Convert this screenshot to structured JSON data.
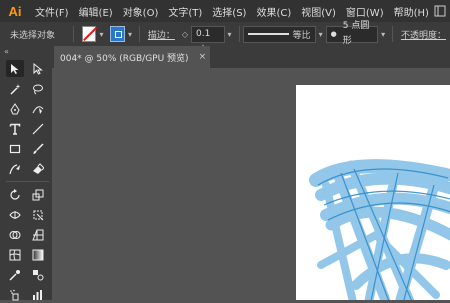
{
  "app": {
    "logo": "Ai"
  },
  "menu": [
    "文件(F)",
    "编辑(E)",
    "对象(O)",
    "文字(T)",
    "选择(S)",
    "效果(C)",
    "视图(V)",
    "窗口(W)",
    "帮助(H)"
  ],
  "control_bar": {
    "selection_status": "未选择对象",
    "stroke_label": "描边：",
    "stroke_width": "0.1 pt",
    "profile_label": "等比",
    "brush_label": "5 点圆形",
    "opacity_label": "不透明度："
  },
  "document_tab": {
    "title": "004* @ 50% (RGB/GPU 预览)",
    "close": "×"
  },
  "toolbar": {
    "collapse": "«"
  },
  "colors": {
    "accent": "#ff9a00",
    "artwork_blue": "#3a9ad9",
    "canvas": "#535353",
    "artboard": "#ffffff"
  },
  "icons": [
    "selection-tool-icon",
    "direct-selection-tool-icon",
    "magic-wand-icon",
    "lasso-icon",
    "pen-tool-icon",
    "curvature-tool-icon",
    "type-tool-icon",
    "line-tool-icon",
    "rectangle-tool-icon",
    "paintbrush-icon",
    "shaper-tool-icon",
    "eraser-icon",
    "rotate-tool-icon",
    "scale-tool-icon",
    "width-tool-icon",
    "free-transform-icon",
    "shape-builder-icon",
    "perspective-grid-icon",
    "mesh-tool-icon",
    "gradient-tool-icon",
    "eyedropper-icon",
    "blend-tool-icon",
    "symbol-sprayer-icon",
    "graph-tool-icon"
  ]
}
